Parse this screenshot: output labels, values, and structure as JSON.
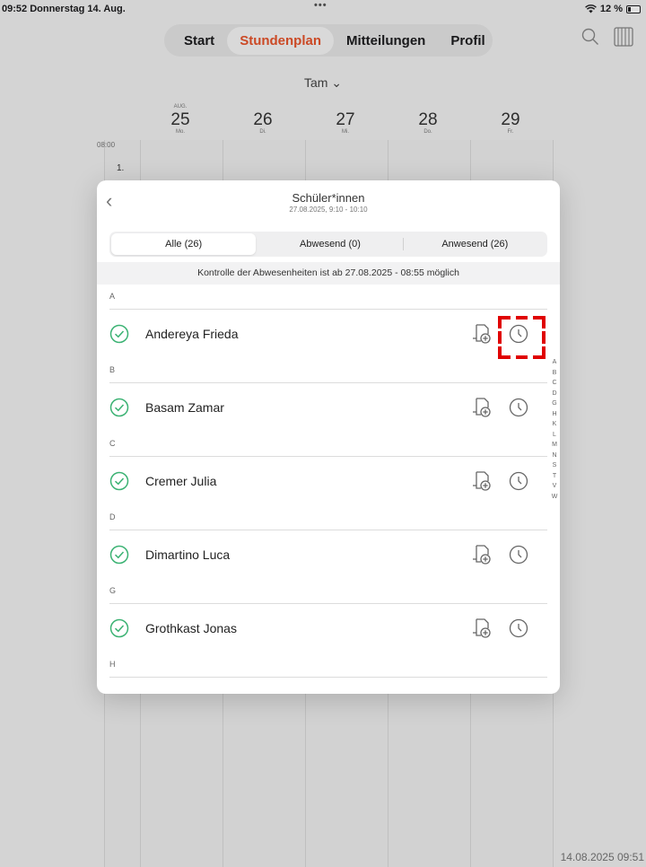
{
  "status_bar": {
    "time": "09:52",
    "date": "Donnerstag 14. Aug.",
    "dots": "•••",
    "battery": "12 %"
  },
  "nav": {
    "tabs": [
      {
        "label": "Start"
      },
      {
        "label": "Stundenplan"
      },
      {
        "label": "Mitteilungen"
      },
      {
        "label": "Profil"
      }
    ],
    "active": "Stundenplan"
  },
  "top_icons": [
    "search-icon",
    "columns-icon"
  ],
  "person_selector": "Tam ⌄",
  "week": {
    "month_label": "AUG.",
    "days": [
      {
        "num": "25",
        "weekday": "Mo."
      },
      {
        "num": "26",
        "weekday": "Di."
      },
      {
        "num": "27",
        "weekday": "Mi."
      },
      {
        "num": "28",
        "weekday": "Do."
      },
      {
        "num": "29",
        "weekday": "Fr."
      }
    ]
  },
  "timetable": {
    "hour_label": "08:00",
    "lesson_label": "1."
  },
  "modal": {
    "title": "Schüler*innen",
    "subtitle": "27.08.2025, 9:10 - 10:10",
    "segments": [
      "Alle (26)",
      "Abwesend (0)",
      "Anwesend (26)"
    ],
    "active_segment": "Alle (26)",
    "notice": "Kontrolle der Abwesenheiten ist ab 27.08.2025 - 08:55 möglich",
    "sections": [
      {
        "letter": "A",
        "students": [
          "Andereya Frieda"
        ]
      },
      {
        "letter": "B",
        "students": [
          "Basam Zamar"
        ]
      },
      {
        "letter": "C",
        "students": [
          "Cremer Julia"
        ]
      },
      {
        "letter": "D",
        "students": [
          "Dimartino Luca"
        ]
      },
      {
        "letter": "G",
        "students": [
          "Grothkast Jonas"
        ]
      },
      {
        "letter": "H",
        "students": []
      }
    ],
    "alphabet_index": [
      "A",
      "B",
      "C",
      "D",
      "G",
      "H",
      "K",
      "L",
      "M",
      "N",
      "S",
      "T",
      "V",
      "W"
    ]
  },
  "footer_date": "14.08.2025 09:51",
  "colors": {
    "accent": "#e8542b",
    "check_green": "#3bb273",
    "focus_red": "#e00000"
  }
}
